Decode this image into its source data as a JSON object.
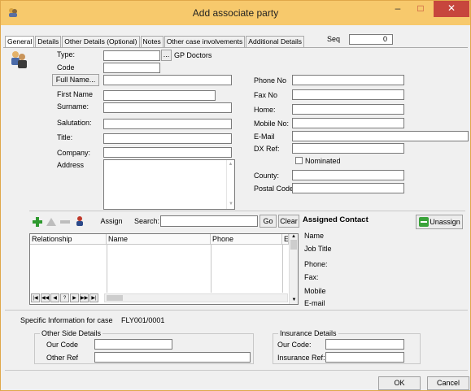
{
  "window": {
    "title": "Add associate party",
    "minimize": "–",
    "maximize": "□",
    "close": "✕"
  },
  "tabs": [
    "General",
    "Details",
    "Other Details (Optional)",
    "Notes",
    "Other case involvements",
    "Additional Details"
  ],
  "seq": {
    "label": "Seq",
    "value": "0"
  },
  "general": {
    "type_label": "Type:",
    "type_value": "",
    "browse_label": "...",
    "type_name": "GP Doctors",
    "code_label": "Code",
    "fullname_button": "Full Name...",
    "firstname_label": "First Name",
    "surname_label": "Surname:",
    "salutation_label": "Salutation:",
    "title_label": "Title:",
    "company_label": "Company:",
    "address_label": "Address",
    "phone_label": "Phone No",
    "fax_label": "Fax No",
    "home_label": "Home:",
    "mobile_label": "Mobile No:",
    "email_label": "E-Mail",
    "dx_label": "DX Ref:",
    "nominated_label": "Nominated",
    "county_label": "County:",
    "postal_label": "Postal Code:"
  },
  "contacts": {
    "assign_label": "Assign",
    "search_label": "Search:",
    "search_value": "",
    "go_label": "Go",
    "clear_label": "Clear",
    "columns": [
      "Relationship",
      "Name",
      "Phone",
      "E"
    ],
    "nav_buttons": [
      "|◀",
      "◀◀",
      "◀",
      "?",
      "▶",
      "▶▶",
      "▶|"
    ]
  },
  "assigned": {
    "heading": "Assigned Contact",
    "unassign_label": "Unassign",
    "fields": [
      "Name",
      "Job Title",
      "Phone:",
      "Fax:",
      "Mobile",
      "E-mail"
    ]
  },
  "specific": {
    "label": "Specific Information for case",
    "case_ref": "FLY001/0001",
    "other_side_title": "Other Side Details",
    "our_code_label": "Our Code",
    "other_ref_label": "Other Ref",
    "insurance_title": "Insurance Details",
    "ins_our_code_label": "Our Code:",
    "ins_ref_label": "Insurance Ref:"
  },
  "footer": {
    "ok_label": "OK",
    "cancel_label": "Cancel"
  },
  "colors": {
    "titlebar": "#f7c96c",
    "close": "#c7463d",
    "add_icon": "#2f9a2f",
    "unassign_icon": "#3aa33a"
  }
}
